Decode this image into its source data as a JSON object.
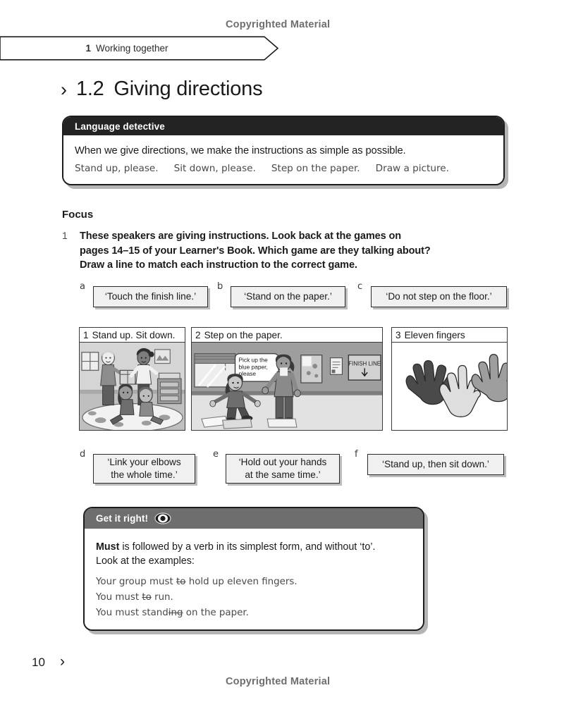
{
  "page": {
    "copyright_top": "Copyrighted Material",
    "copyright_bottom": "Copyrighted Material",
    "page_number": "10",
    "page_chevron": "›"
  },
  "chapter_tab": {
    "number": "1",
    "title": "Working together"
  },
  "unit_heading": {
    "chevron": "›",
    "number": "1.2",
    "title": "Giving directions"
  },
  "language_detective": {
    "bar_title": "Language detective",
    "lead": "When we give directions, we make the instructions as simple as possible.",
    "examples": [
      "Stand up, please.",
      "Sit down, please.",
      "Step on the paper.",
      "Draw a picture."
    ]
  },
  "focus": {
    "heading": "Focus",
    "task_number": "1",
    "task_lines": [
      "These speakers are giving instructions. Look back at the games on",
      "pages 14–15 of your Learner's Book. Which game are they talking about?",
      "Draw a line to match each instruction to the correct game."
    ]
  },
  "quotes_top": [
    {
      "label": "a",
      "text": "‘Touch the finish line.’"
    },
    {
      "label": "b",
      "text": "‘Stand on the paper.’"
    },
    {
      "label": "c",
      "text": "‘Do not step on the floor.’"
    }
  ],
  "quotes_bottom": [
    {
      "label": "d",
      "line1": "‘Link your elbows",
      "line2": "the whole time.’"
    },
    {
      "label": "e",
      "line1": "‘Hold out your hands",
      "line2": "at the same time.’"
    },
    {
      "label": "f",
      "line1": "‘Stand up, then sit down.’",
      "line2": ""
    }
  ],
  "panels": [
    {
      "number": "1",
      "caption": "Stand up. Sit down.",
      "scene": "classroom-two-standing-two-seated-back-to-back-on-rug"
    },
    {
      "number": "2",
      "caption": "Step on the paper.",
      "scene": "classroom-child-stepping-on-paper-sheets",
      "speech_bubble": [
        "Pick up the",
        "blue paper,",
        "please"
      ],
      "sign_text": "FINISH LINE"
    },
    {
      "number": "3",
      "caption": "Eleven fingers",
      "scene": "three-raised-hands-different-skin-tones"
    }
  ],
  "get_it_right": {
    "bar_title": "Get it right!",
    "icon": "eye-icon",
    "rule_bold": "Must",
    "rule_rest": " is followed by a verb in its simplest form, and without ‘to’.",
    "rule_line2": "Look at the examples:",
    "examples": [
      {
        "before": "Your group must ",
        "struck": "to",
        "after": " hold up eleven fingers."
      },
      {
        "before": "You must ",
        "struck": "to",
        "after": " run."
      },
      {
        "before": "You must stand",
        "struck": "ing",
        "after": " on the paper."
      }
    ]
  },
  "colors": {
    "ink": "#1a1a1a",
    "muted": "#6e6e6e",
    "bar_dark": "#232323",
    "bar_grey": "#6e6e6e",
    "box_fill": "#f0f0f0",
    "shadow": "#bdbdbd"
  }
}
